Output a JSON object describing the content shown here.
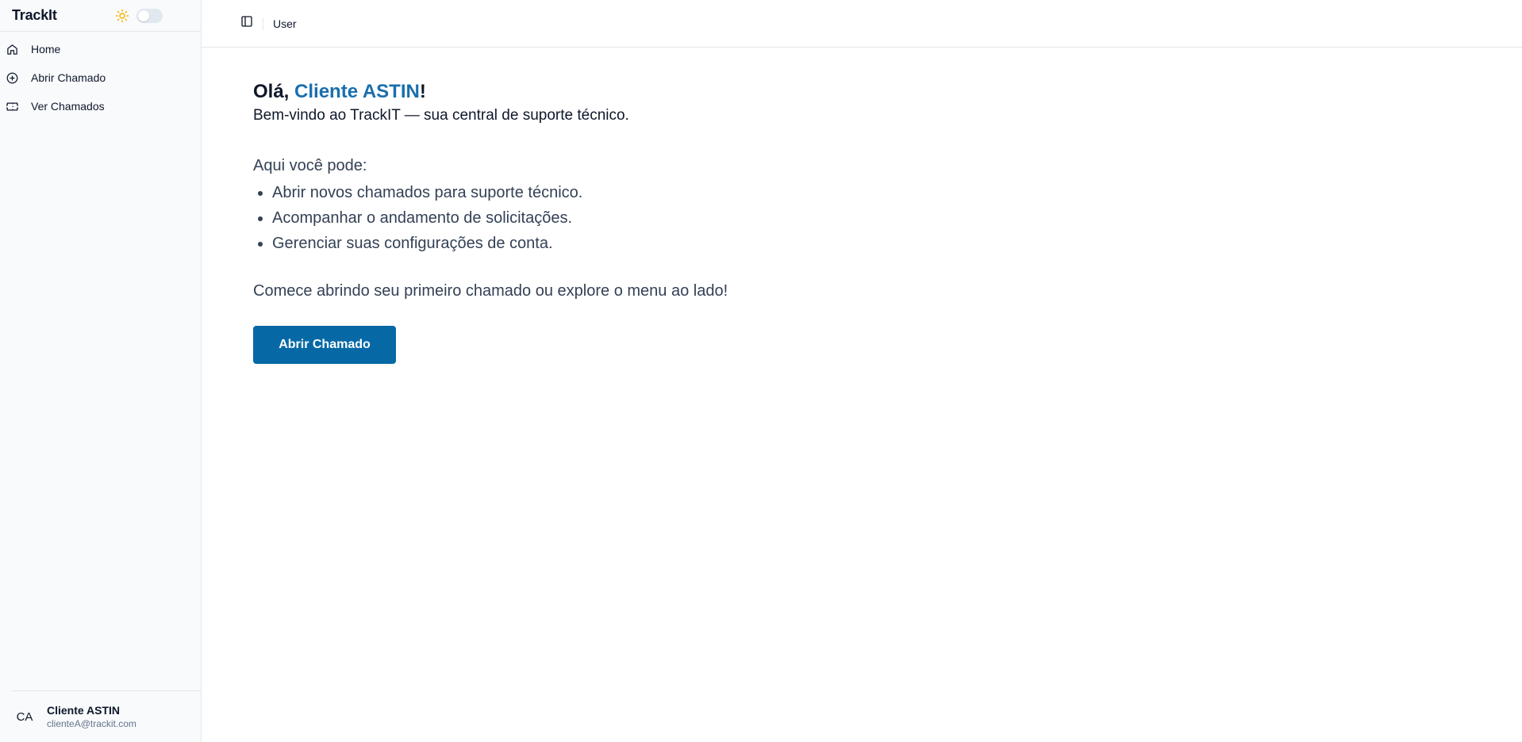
{
  "app": {
    "brand": "TrackIt"
  },
  "theme": {
    "icon": "sun-icon",
    "mode": "light",
    "accent": "#f5b301"
  },
  "sidebar": {
    "items": [
      {
        "label": "Home",
        "icon": "home-icon"
      },
      {
        "label": "Abrir Chamado",
        "icon": "plus-circle-icon"
      },
      {
        "label": "Ver Chamados",
        "icon": "ticket-icon"
      }
    ]
  },
  "user": {
    "initials": "CA",
    "name": "Cliente ASTIN",
    "email": "clienteA@trackit.com"
  },
  "header": {
    "breadcrumb": "User"
  },
  "main": {
    "greeting_prefix": "Olá, ",
    "greeting_name": "Cliente ASTIN",
    "greeting_suffix": "!",
    "subtitle": "Bem-vindo ao TrackIT — sua central de suporte técnico.",
    "lead": "Aqui você pode:",
    "features": [
      "Abrir novos chamados para suporte técnico.",
      "Acompanhar o andamento de solicitações.",
      "Gerenciar suas configurações de conta."
    ],
    "cta_text": "Comece abrindo seu primeiro chamado ou explore o menu ao lado!",
    "cta_button": "Abrir Chamado"
  },
  "colors": {
    "primary": "#0669a6",
    "link": "#1a6fad",
    "sidebar_bg": "#f8fafc"
  }
}
